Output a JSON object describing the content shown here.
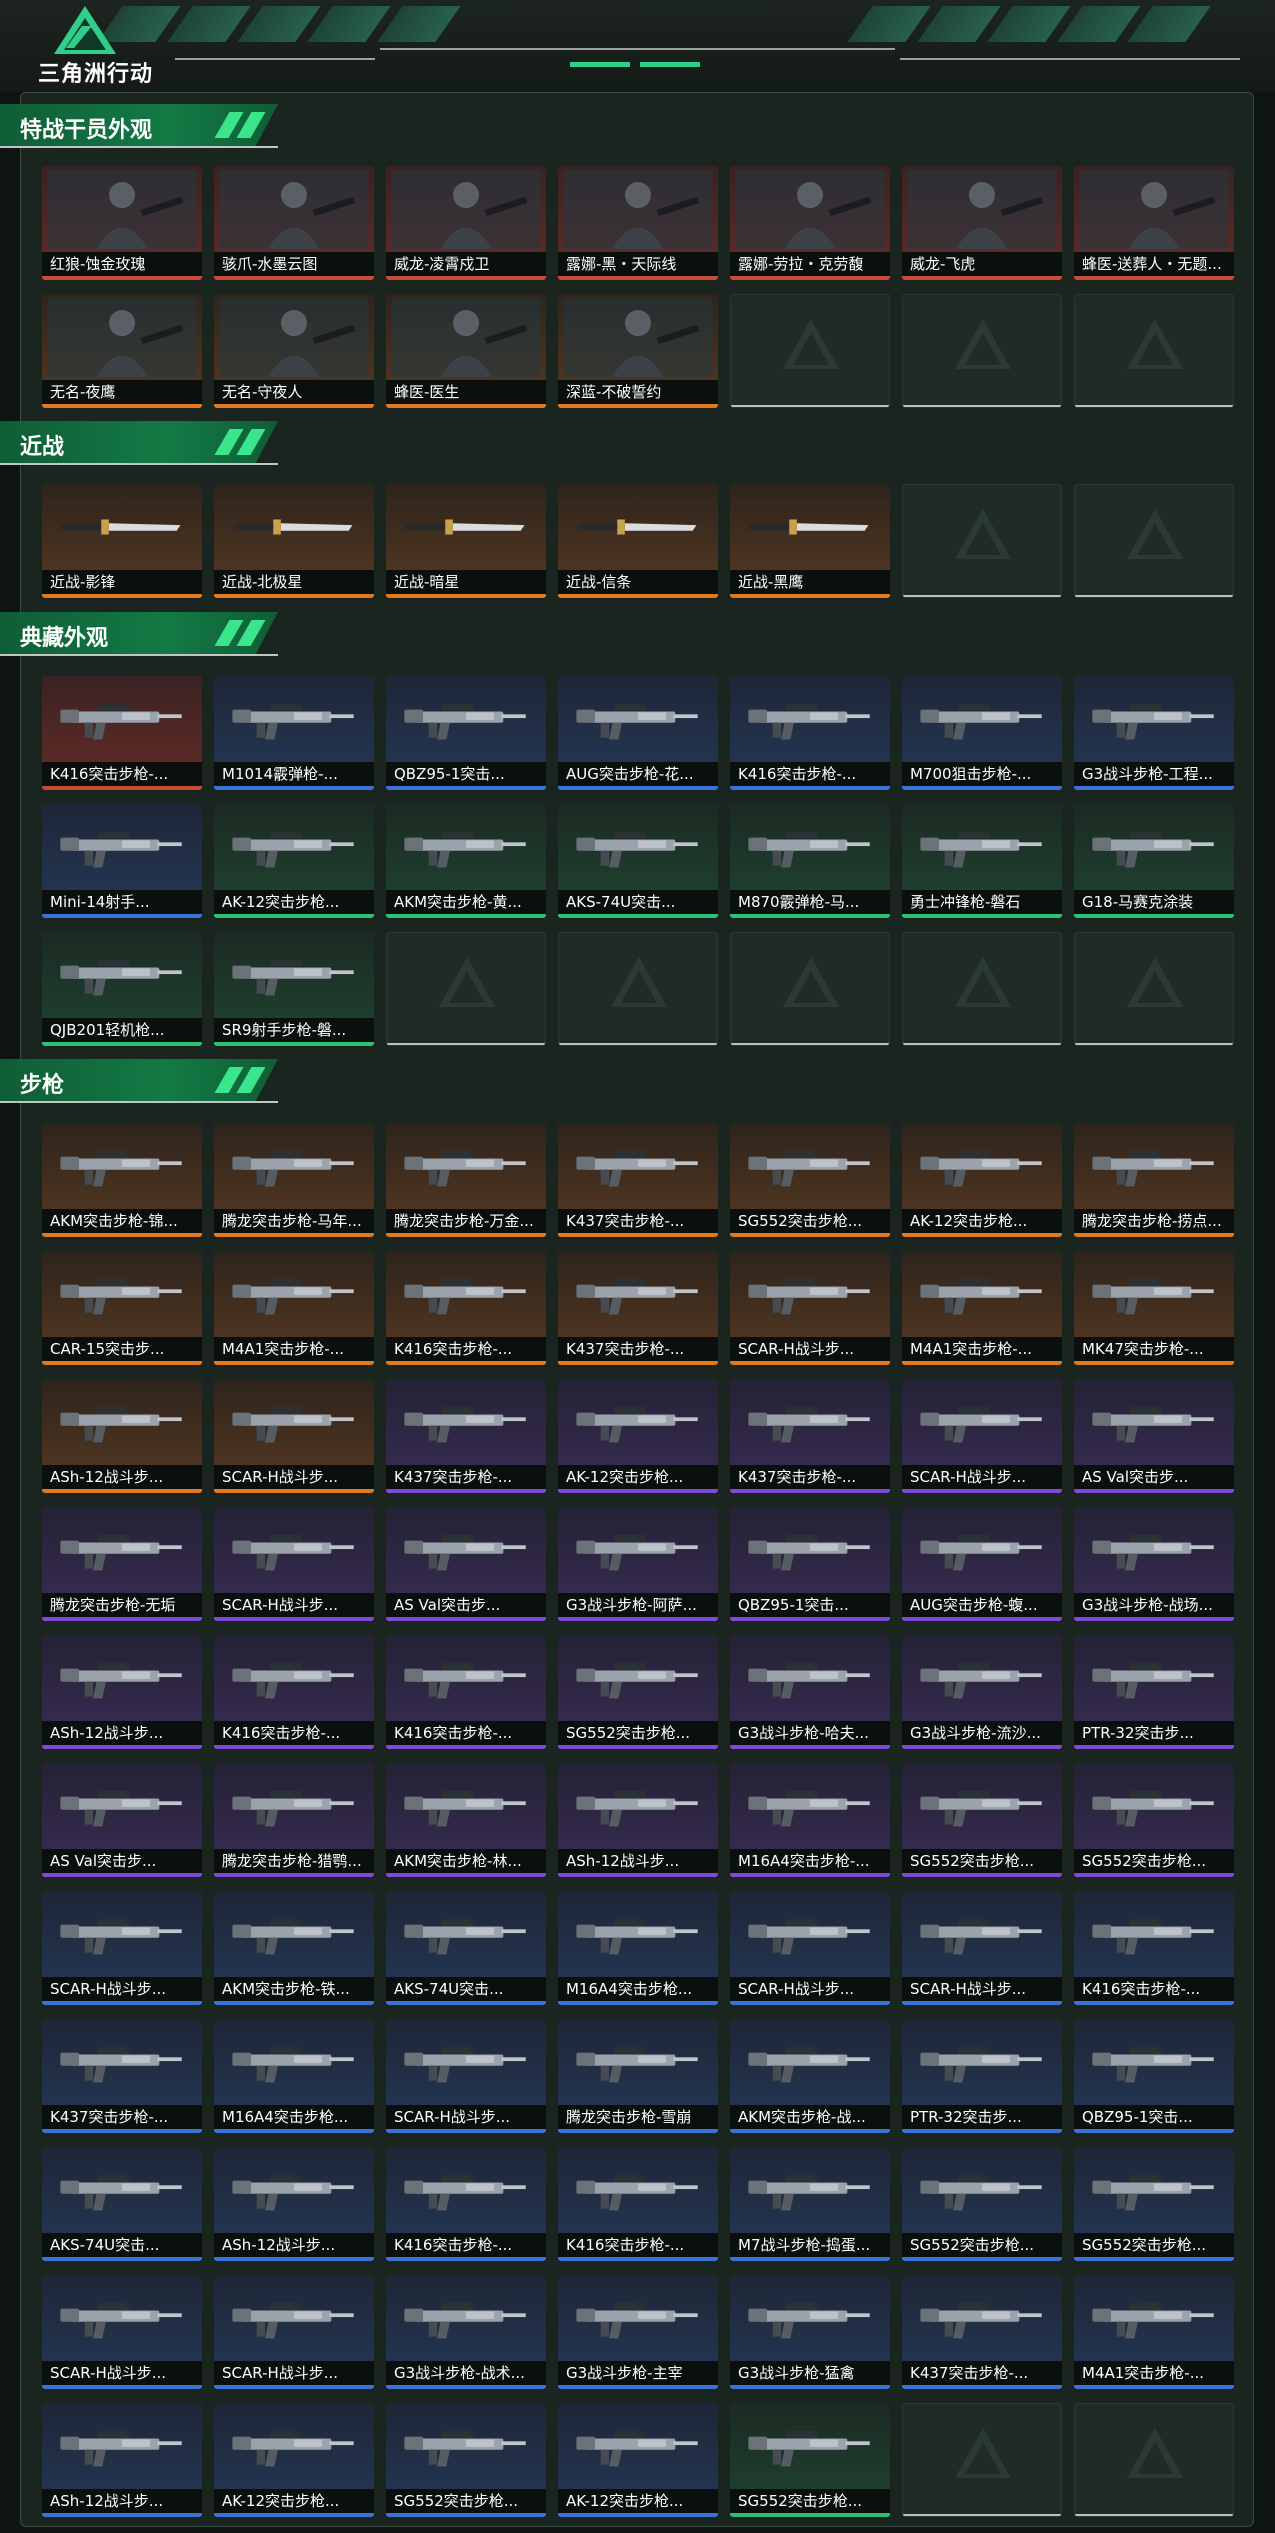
{
  "app": {
    "logo_text": "三角洲行动"
  },
  "sections": [
    {
      "id": "operators",
      "title": "特战干员外观",
      "empty_slots": 3,
      "items": [
        {
          "label": "红狼-蚀金玫瑰",
          "rarity": "red",
          "kind": "operator"
        },
        {
          "label": "骇爪-水墨云图",
          "rarity": "red",
          "kind": "operator"
        },
        {
          "label": "威龙-凌霄戍卫",
          "rarity": "red",
          "kind": "operator"
        },
        {
          "label": "露娜-黑・天际线",
          "rarity": "red",
          "kind": "operator"
        },
        {
          "label": "露娜-劳拉・克劳馥",
          "rarity": "red",
          "kind": "operator"
        },
        {
          "label": "威龙-飞虎",
          "rarity": "red",
          "kind": "operator"
        },
        {
          "label": "蜂医-送葬人・无题...",
          "rarity": "red",
          "kind": "operator"
        },
        {
          "label": "无名-夜鹰",
          "rarity": "orange",
          "kind": "operator"
        },
        {
          "label": "无名-守夜人",
          "rarity": "orange",
          "kind": "operator"
        },
        {
          "label": "蜂医-医生",
          "rarity": "orange",
          "kind": "operator"
        },
        {
          "label": "深蓝-不破誓约",
          "rarity": "orange",
          "kind": "operator"
        }
      ]
    },
    {
      "id": "melee",
      "title": "近战",
      "empty_slots": 2,
      "items": [
        {
          "label": "近战-影锋",
          "rarity": "orange",
          "kind": "knife"
        },
        {
          "label": "近战-北极星",
          "rarity": "orange",
          "kind": "knife"
        },
        {
          "label": "近战-暗星",
          "rarity": "orange",
          "kind": "knife"
        },
        {
          "label": "近战-信条",
          "rarity": "orange",
          "kind": "knife"
        },
        {
          "label": "近战-黑鹰",
          "rarity": "orange",
          "kind": "knife"
        }
      ]
    },
    {
      "id": "collection",
      "title": "典藏外观",
      "empty_slots": 5,
      "items": [
        {
          "label": "K416突击步枪-...",
          "rarity": "red",
          "kind": "gun"
        },
        {
          "label": "M1014霰弹枪-...",
          "rarity": "blue",
          "kind": "gun"
        },
        {
          "label": "QBZ95-1突击...",
          "rarity": "blue",
          "kind": "gun"
        },
        {
          "label": "AUG突击步枪-花...",
          "rarity": "blue",
          "kind": "gun"
        },
        {
          "label": "K416突击步枪-...",
          "rarity": "blue",
          "kind": "gun"
        },
        {
          "label": "M700狙击步枪-...",
          "rarity": "blue",
          "kind": "gun"
        },
        {
          "label": "G3战斗步枪-工程...",
          "rarity": "blue",
          "kind": "gun"
        },
        {
          "label": "Mini-14射手...",
          "rarity": "blue",
          "kind": "gun"
        },
        {
          "label": "AK-12突击步枪...",
          "rarity": "green",
          "kind": "gun"
        },
        {
          "label": "AKM突击步枪-黄...",
          "rarity": "green",
          "kind": "gun"
        },
        {
          "label": "AKS-74U突击...",
          "rarity": "green",
          "kind": "gun"
        },
        {
          "label": "M870霰弹枪-马...",
          "rarity": "green",
          "kind": "gun"
        },
        {
          "label": "勇士冲锋枪-磐石",
          "rarity": "green",
          "kind": "gun"
        },
        {
          "label": "G18-马赛克涂装",
          "rarity": "green",
          "kind": "gun"
        },
        {
          "label": "QJB201轻机枪...",
          "rarity": "green",
          "kind": "gun"
        },
        {
          "label": "SR9射手步枪-磐...",
          "rarity": "green",
          "kind": "gun"
        }
      ]
    },
    {
      "id": "rifles",
      "title": "步枪",
      "empty_slots": 2,
      "items": [
        {
          "label": "AKM突击步枪-锦...",
          "rarity": "orange",
          "kind": "gun"
        },
        {
          "label": "腾龙突击步枪-马年...",
          "rarity": "orange",
          "kind": "gun"
        },
        {
          "label": "腾龙突击步枪-万金...",
          "rarity": "orange",
          "kind": "gun"
        },
        {
          "label": "K437突击步枪-...",
          "rarity": "orange",
          "kind": "gun"
        },
        {
          "label": "SG552突击步枪...",
          "rarity": "orange",
          "kind": "gun"
        },
        {
          "label": "AK-12突击步枪...",
          "rarity": "orange",
          "kind": "gun"
        },
        {
          "label": "腾龙突击步枪-捞点...",
          "rarity": "orange",
          "kind": "gun"
        },
        {
          "label": "CAR-15突击步...",
          "rarity": "orange",
          "kind": "gun"
        },
        {
          "label": "M4A1突击步枪-...",
          "rarity": "orange",
          "kind": "gun"
        },
        {
          "label": "K416突击步枪-...",
          "rarity": "orange",
          "kind": "gun"
        },
        {
          "label": "K437突击步枪-...",
          "rarity": "orange",
          "kind": "gun"
        },
        {
          "label": "SCAR-H战斗步...",
          "rarity": "orange",
          "kind": "gun"
        },
        {
          "label": "M4A1突击步枪-...",
          "rarity": "orange",
          "kind": "gun"
        },
        {
          "label": "MK47突击步枪-...",
          "rarity": "orange",
          "kind": "gun"
        },
        {
          "label": "ASh-12战斗步...",
          "rarity": "orange",
          "kind": "gun"
        },
        {
          "label": "SCAR-H战斗步...",
          "rarity": "orange",
          "kind": "gun"
        },
        {
          "label": "K437突击步枪-...",
          "rarity": "purple",
          "kind": "gun"
        },
        {
          "label": "AK-12突击步枪...",
          "rarity": "purple",
          "kind": "gun"
        },
        {
          "label": "K437突击步枪-...",
          "rarity": "purple",
          "kind": "gun"
        },
        {
          "label": "SCAR-H战斗步...",
          "rarity": "purple",
          "kind": "gun"
        },
        {
          "label": "AS Val突击步...",
          "rarity": "purple",
          "kind": "gun"
        },
        {
          "label": "腾龙突击步枪-无垢",
          "rarity": "purple",
          "kind": "gun"
        },
        {
          "label": "SCAR-H战斗步...",
          "rarity": "purple",
          "kind": "gun"
        },
        {
          "label": "AS Val突击步...",
          "rarity": "purple",
          "kind": "gun"
        },
        {
          "label": "G3战斗步枪-阿萨...",
          "rarity": "purple",
          "kind": "gun"
        },
        {
          "label": "QBZ95-1突击...",
          "rarity": "purple",
          "kind": "gun"
        },
        {
          "label": "AUG突击步枪-蝮...",
          "rarity": "purple",
          "kind": "gun"
        },
        {
          "label": "G3战斗步枪-战场...",
          "rarity": "purple",
          "kind": "gun"
        },
        {
          "label": "ASh-12战斗步...",
          "rarity": "purple",
          "kind": "gun"
        },
        {
          "label": "K416突击步枪-...",
          "rarity": "purple",
          "kind": "gun"
        },
        {
          "label": "K416突击步枪-...",
          "rarity": "purple",
          "kind": "gun"
        },
        {
          "label": "SG552突击步枪...",
          "rarity": "purple",
          "kind": "gun"
        },
        {
          "label": "G3战斗步枪-哈夫...",
          "rarity": "purple",
          "kind": "gun"
        },
        {
          "label": "G3战斗步枪-流沙...",
          "rarity": "purple",
          "kind": "gun"
        },
        {
          "label": "PTR-32突击步...",
          "rarity": "purple",
          "kind": "gun"
        },
        {
          "label": "AS Val突击步...",
          "rarity": "purple",
          "kind": "gun"
        },
        {
          "label": "腾龙突击步枪-猎鹗...",
          "rarity": "purple",
          "kind": "gun"
        },
        {
          "label": "AKM突击步枪-林...",
          "rarity": "purple",
          "kind": "gun"
        },
        {
          "label": "ASh-12战斗步...",
          "rarity": "purple",
          "kind": "gun"
        },
        {
          "label": "M16A4突击步枪-...",
          "rarity": "purple",
          "kind": "gun"
        },
        {
          "label": "SG552突击步枪...",
          "rarity": "purple",
          "kind": "gun"
        },
        {
          "label": "SG552突击步枪...",
          "rarity": "purple",
          "kind": "gun"
        },
        {
          "label": "SCAR-H战斗步...",
          "rarity": "blue",
          "kind": "gun"
        },
        {
          "label": "AKM突击步枪-铁...",
          "rarity": "blue",
          "kind": "gun"
        },
        {
          "label": "AKS-74U突击...",
          "rarity": "blue",
          "kind": "gun"
        },
        {
          "label": "M16A4突击步枪...",
          "rarity": "blue",
          "kind": "gun"
        },
        {
          "label": "SCAR-H战斗步...",
          "rarity": "blue",
          "kind": "gun"
        },
        {
          "label": "SCAR-H战斗步...",
          "rarity": "blue",
          "kind": "gun"
        },
        {
          "label": "K416突击步枪-...",
          "rarity": "blue",
          "kind": "gun"
        },
        {
          "label": "K437突击步枪-...",
          "rarity": "blue",
          "kind": "gun"
        },
        {
          "label": "M16A4突击步枪...",
          "rarity": "blue",
          "kind": "gun"
        },
        {
          "label": "SCAR-H战斗步...",
          "rarity": "blue",
          "kind": "gun"
        },
        {
          "label": "腾龙突击步枪-雪崩",
          "rarity": "blue",
          "kind": "gun"
        },
        {
          "label": "AKM突击步枪-战...",
          "rarity": "blue",
          "kind": "gun"
        },
        {
          "label": "PTR-32突击步...",
          "rarity": "blue",
          "kind": "gun"
        },
        {
          "label": "QBZ95-1突击...",
          "rarity": "blue",
          "kind": "gun"
        },
        {
          "label": "AKS-74U突击...",
          "rarity": "blue",
          "kind": "gun"
        },
        {
          "label": "ASh-12战斗步...",
          "rarity": "blue",
          "kind": "gun"
        },
        {
          "label": "K416突击步枪-...",
          "rarity": "blue",
          "kind": "gun"
        },
        {
          "label": "K416突击步枪-...",
          "rarity": "blue",
          "kind": "gun"
        },
        {
          "label": "M7战斗步枪-捣蛋...",
          "rarity": "blue",
          "kind": "gun"
        },
        {
          "label": "SG552突击步枪...",
          "rarity": "blue",
          "kind": "gun"
        },
        {
          "label": "SG552突击步枪...",
          "rarity": "blue",
          "kind": "gun"
        },
        {
          "label": "SCAR-H战斗步...",
          "rarity": "blue",
          "kind": "gun"
        },
        {
          "label": "SCAR-H战斗步...",
          "rarity": "blue",
          "kind": "gun"
        },
        {
          "label": "G3战斗步枪-战术...",
          "rarity": "blue",
          "kind": "gun"
        },
        {
          "label": "G3战斗步枪-主宰",
          "rarity": "blue",
          "kind": "gun"
        },
        {
          "label": "G3战斗步枪-猛禽",
          "rarity": "blue",
          "kind": "gun"
        },
        {
          "label": "K437突击步枪-...",
          "rarity": "blue",
          "kind": "gun"
        },
        {
          "label": "M4A1突击步枪-...",
          "rarity": "blue",
          "kind": "gun"
        },
        {
          "label": "ASh-12战斗步...",
          "rarity": "blue",
          "kind": "gun"
        },
        {
          "label": "AK-12突击步枪...",
          "rarity": "blue",
          "kind": "gun"
        },
        {
          "label": "SG552突击步枪...",
          "rarity": "blue",
          "kind": "gun"
        },
        {
          "label": "AK-12突击步枪...",
          "rarity": "blue",
          "kind": "gun"
        },
        {
          "label": "SG552突击步枪...",
          "rarity": "green",
          "kind": "gun"
        }
      ]
    }
  ],
  "colors": {
    "accent": "#2fcf8a",
    "panel_bg": "#1a2520",
    "page_bg": "#0e1411",
    "header_green": "#137a45",
    "rarity_red": "#c94a33",
    "rarity_orange": "#e27a21",
    "rarity_purple": "#7d4ad8",
    "rarity_blue": "#3b72d6",
    "rarity_green": "#2fbf72"
  }
}
